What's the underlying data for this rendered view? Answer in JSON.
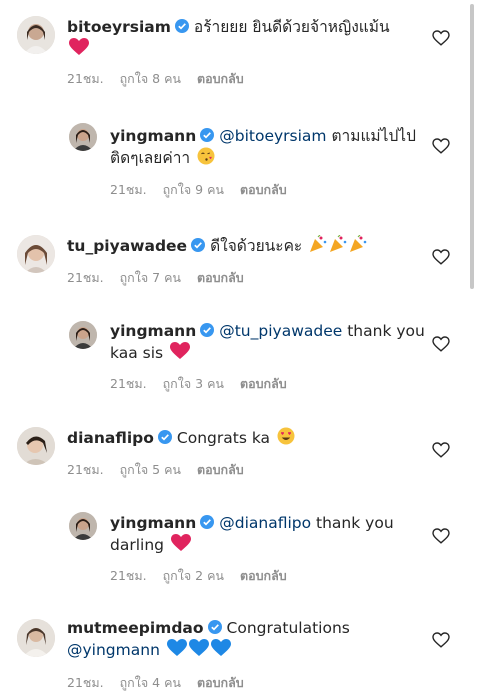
{
  "comments": [
    {
      "username": "bitoeyrsiam",
      "text": "อร้ายยย ยินดีด้วยจ้าหญิงแม้น",
      "time": "21ชม.",
      "likes": "ถูกใจ 8 คน",
      "reply": "ตอบกลับ"
    },
    {
      "username": "yingmann",
      "mention": "@bitoeyrsiam",
      "text": "ตามแม่ไปไปติดๆเลยค่าา",
      "time": "21ชม.",
      "likes": "ถูกใจ 9 คน",
      "reply": "ตอบกลับ"
    },
    {
      "username": "tu_piyawadee",
      "text": "ดีใจด้วยนะคะ",
      "time": "21ชม.",
      "likes": "ถูกใจ 7 คน",
      "reply": "ตอบกลับ"
    },
    {
      "username": "yingmann",
      "mention": "@tu_piyawadee",
      "text": "thank you kaa sis",
      "time": "21ชม.",
      "likes": "ถูกใจ 3 คน",
      "reply": "ตอบกลับ"
    },
    {
      "username": "dianaflipo",
      "text": "Congrats ka",
      "time": "21ชม.",
      "likes": "ถูกใจ 5 คน",
      "reply": "ตอบกลับ"
    },
    {
      "username": "yingmann",
      "mention": "@dianaflipo",
      "text": "thank you darling",
      "time": "21ชม.",
      "likes": "ถูกใจ 2 คน",
      "reply": "ตอบกลับ"
    },
    {
      "username": "mutmeepimdao",
      "text": "Congratulations",
      "mention": "@yingmann",
      "time": "21ชม.",
      "likes": "ถูกใจ 4 คน",
      "reply": "ตอบกลับ"
    }
  ],
  "colors": {
    "verified": "#3897f0",
    "heart_red": "#e0245e",
    "heart_blue": "#1e88e5",
    "meta": "#8e8e8e"
  },
  "icons": {
    "verified": "verified-badge-icon",
    "like": "heart-outline-icon"
  }
}
